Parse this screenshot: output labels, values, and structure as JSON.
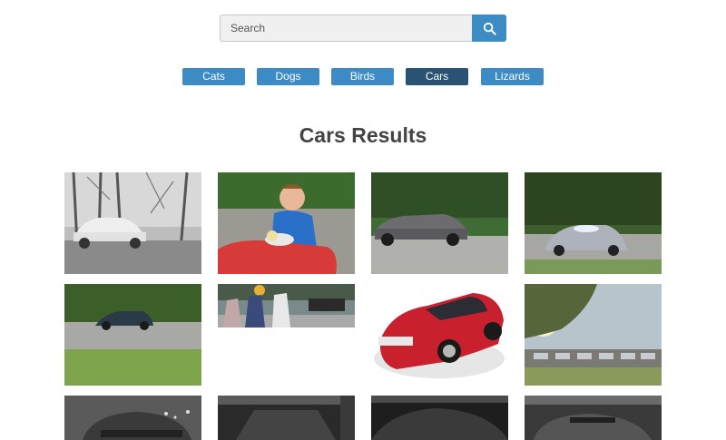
{
  "search": {
    "placeholder": "Search",
    "icon": "search-icon"
  },
  "categories": [
    {
      "label": "Cats",
      "active": false
    },
    {
      "label": "Dogs",
      "active": false
    },
    {
      "label": "Birds",
      "active": false
    },
    {
      "label": "Cars",
      "active": true
    },
    {
      "label": "Lizards",
      "active": false
    }
  ],
  "results": {
    "heading": "Cars Results"
  },
  "colors": {
    "accent": "#3d8bc4",
    "active": "#2a5275"
  }
}
